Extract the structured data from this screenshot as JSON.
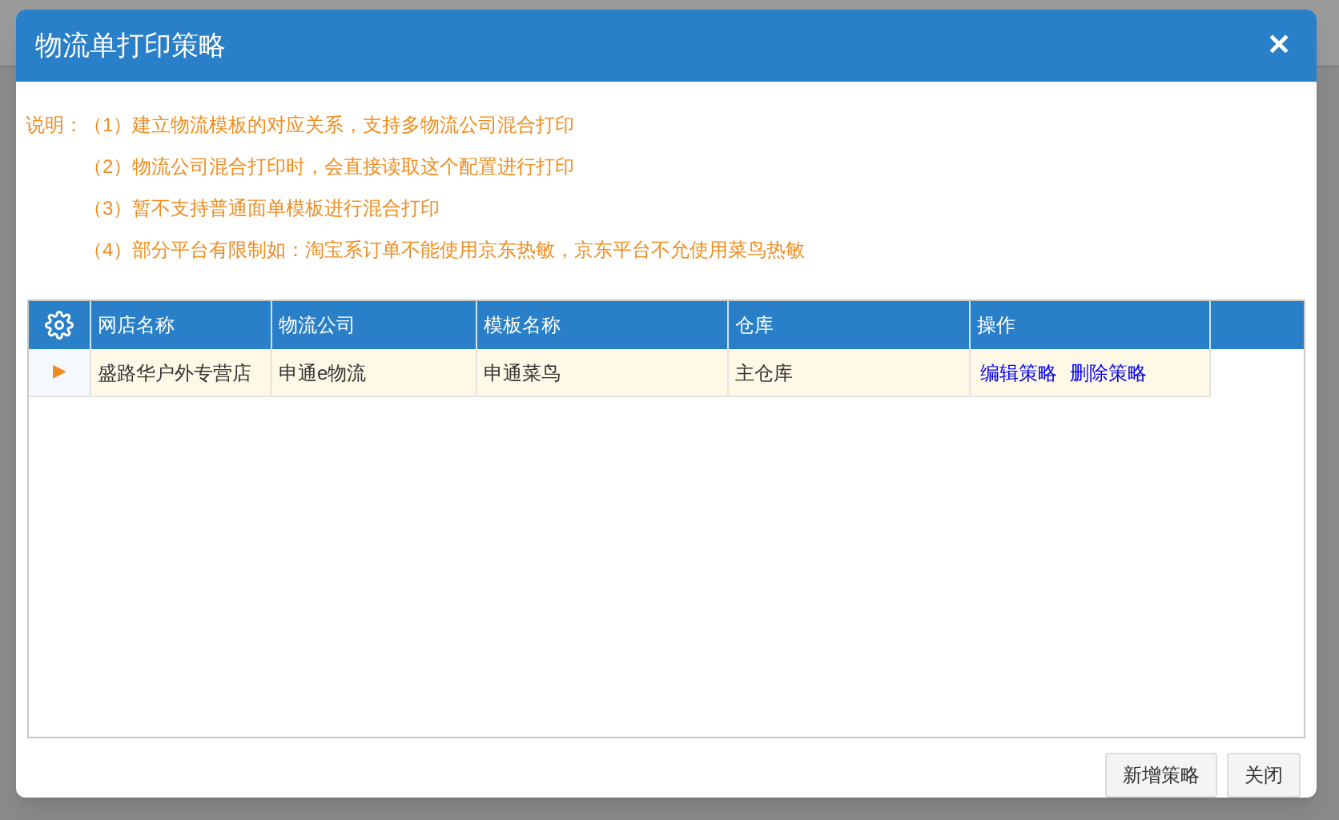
{
  "dialog": {
    "title": "物流单打印策略",
    "close": "✕"
  },
  "notes": {
    "label": "说明：",
    "items": [
      "（1）建立物流模板的对应关系，支持多物流公司混合打印",
      "（2）物流公司混合打印时，会直接读取这个配置进行打印",
      "（3）暂不支持普通面单模板进行混合打印",
      "（4）部分平台有限制如：淘宝系订单不能使用京东热敏，京东平台不允使用菜鸟热敏"
    ]
  },
  "table": {
    "columns": [
      "网店名称",
      "物流公司",
      "模板名称",
      "仓库",
      "操作"
    ],
    "rows": [
      {
        "selected": true,
        "marker": "▶",
        "cells": [
          "盛路华户外专营店",
          "申通e物流",
          "申通菜鸟",
          "主仓库"
        ],
        "actions": [
          "编辑策略",
          "删除策略"
        ]
      }
    ]
  },
  "buttons": [
    "新增策略",
    "关闭"
  ]
}
